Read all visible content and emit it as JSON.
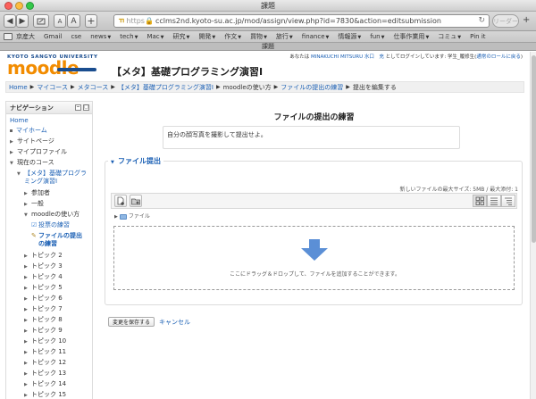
{
  "window": {
    "title": "課題"
  },
  "toolbar": {
    "font_small": "A",
    "font_large": "A",
    "url_scheme": "https",
    "url_text": "cclms2nd.kyoto-su.ac.jp/mod/assign/view.php?id=7830&action=editsubmission",
    "reader_label": "リーダー"
  },
  "bookmarks": [
    {
      "label": "京産大"
    },
    {
      "label": "Gmail"
    },
    {
      "label": "cse"
    },
    {
      "label": "news",
      "menu": "▼"
    },
    {
      "label": "tech",
      "menu": "▼"
    },
    {
      "label": "Mac",
      "menu": "▼"
    },
    {
      "label": "研究",
      "menu": "▼"
    },
    {
      "label": "開発",
      "menu": "▼"
    },
    {
      "label": "作文",
      "menu": "▼"
    },
    {
      "label": "買物",
      "menu": "▼"
    },
    {
      "label": "旅行",
      "menu": "▼"
    },
    {
      "label": "finance",
      "menu": "▼"
    },
    {
      "label": "情報源",
      "menu": "▼"
    },
    {
      "label": "fun",
      "menu": "▼"
    },
    {
      "label": "仕事作業用",
      "menu": "▼"
    },
    {
      "label": "コミュ",
      "menu": "▼"
    },
    {
      "label": "Pin it"
    }
  ],
  "tab": {
    "title": "課題"
  },
  "header": {
    "logo_university": "KYOTO SANGYO UNIVERSITY",
    "logo_word": "moodle",
    "login_prefix": "あなたは",
    "login_user": "MINAKUCHI MITSURU 水口　充",
    "login_middle": "としてログインしています: 学生_履修生(",
    "login_role_link": "通常のロールに戻る",
    "login_suffix": ")",
    "course_title": "【メタ】基礎プログラミング演習I"
  },
  "breadcrumb": [
    {
      "label": "Home",
      "link": true
    },
    {
      "label": "マイコース",
      "link": true
    },
    {
      "label": "メタコース",
      "link": true
    },
    {
      "label": "【メタ】基礎プログラミング演習I",
      "link": true
    },
    {
      "label": "moodleの使い方",
      "link": false
    },
    {
      "label": "ファイルの提出の練習",
      "link": true
    },
    {
      "label": "提出を編集する",
      "link": false
    }
  ],
  "breadcrumb_sep": "▶",
  "sidebar": {
    "title": "ナビゲーション",
    "ctrl_min": "−",
    "ctrl_max": "□",
    "home": "Home",
    "my_home": "マイホーム",
    "site_pages": "サイトページ",
    "my_profile": "マイプロファイル",
    "current_course": "現在のコース",
    "course_line1": "【メタ】基礎プログラ",
    "course_line2": "ミング演習I",
    "participants": "参加者",
    "general": "一般",
    "moodle_usage": "moodleの使い方",
    "vote_practice": "投票の練習",
    "file_practice_line1": "ファイルの提出",
    "file_practice_line2": "の練習",
    "topics": [
      "トピック 2",
      "トピック 3",
      "トピック 4",
      "トピック 5",
      "トピック 6",
      "トピック 7",
      "トピック 8",
      "トピック 9",
      "トピック 10",
      "トピック 11",
      "トピック 12",
      "トピック 13",
      "トピック 14",
      "トピック 15"
    ]
  },
  "main": {
    "title": "ファイルの提出の練習",
    "intro": "自分の顔写真を撮影して提出せよ。",
    "fieldset_legend": "ファイル提出",
    "max_size": "新しいファイルの最大サイズ: 5MB / 最大添付: 1",
    "path_label": "ファイル",
    "drop_text": "ここにドラッグ＆ドロップして、ファイルを追加することができます。",
    "save_button": "変更を保存する",
    "cancel_link": "キャンセル"
  },
  "colors": {
    "link": "#1a5fb4",
    "logo_orange": "#f28c00",
    "logo_blue": "#1a4d8f",
    "drop_arrow": "#5b8fd6"
  }
}
